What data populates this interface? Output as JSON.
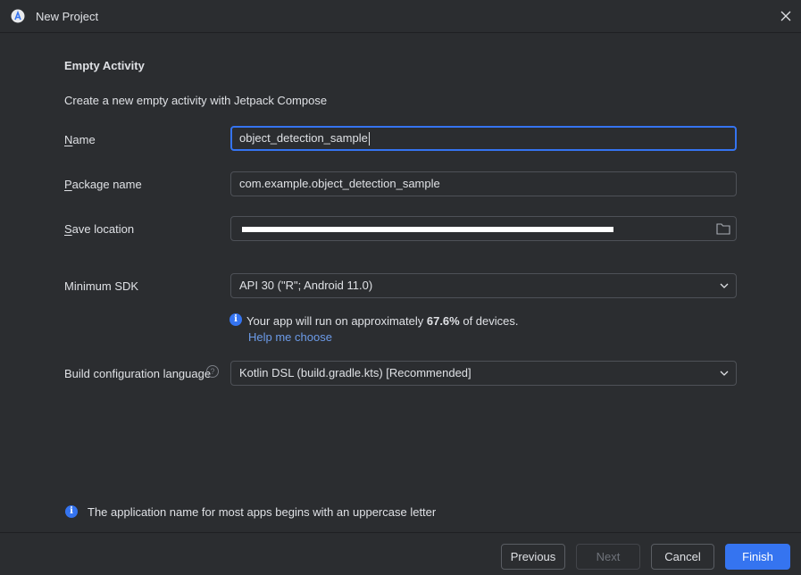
{
  "window": {
    "title": "New Project"
  },
  "form": {
    "heading": "Empty Activity",
    "description": "Create a new empty activity with Jetpack Compose",
    "name": {
      "label_accel": "N",
      "label_rest": "ame",
      "value": "object_detection_sample"
    },
    "package": {
      "label_accel": "P",
      "label_rest": "ackage name",
      "value": "com.example.object_detection_sample"
    },
    "save_location": {
      "label_accel": "S",
      "label_rest": "ave location"
    },
    "min_sdk": {
      "label": "Minimum SDK",
      "value": "API 30 (\"R\"; Android 11.0)"
    },
    "sdk_info": {
      "prefix": "Your app will run on approximately ",
      "percent": "67.6%",
      "suffix": " of devices.",
      "help_link": "Help me choose"
    },
    "build_config": {
      "label": "Build configuration language",
      "value": "Kotlin DSL (build.gradle.kts) [Recommended]"
    },
    "hint": "The application name for most apps begins with an uppercase letter"
  },
  "footer": {
    "previous": "Previous",
    "next": "Next",
    "cancel": "Cancel",
    "finish": "Finish"
  },
  "colors": {
    "accent": "#3574f0",
    "background": "#2b2d30",
    "link": "#6c9be8"
  }
}
